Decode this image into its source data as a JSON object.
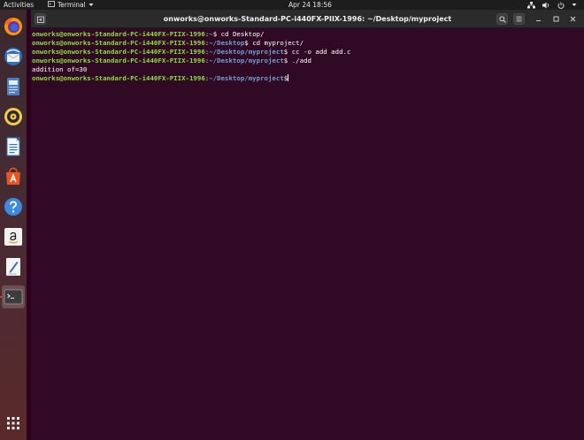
{
  "topbar": {
    "activities": "Activities",
    "app_menu": "Terminal",
    "clock": "Apr 24  18:56"
  },
  "dock": {
    "items": [
      {
        "name": "firefox",
        "icon": "firefox-icon"
      },
      {
        "name": "thunderbird",
        "icon": "thunderbird-mail-icon"
      },
      {
        "name": "files",
        "icon": "files-icon"
      },
      {
        "name": "rhythmbox",
        "icon": "rhythmbox-icon"
      },
      {
        "name": "libreoffice-writer",
        "icon": "libreoffice-writer-icon"
      },
      {
        "name": "ubuntu-software",
        "icon": "ubuntu-software-icon"
      },
      {
        "name": "help",
        "icon": "help-icon"
      },
      {
        "name": "amazon",
        "icon": "amazon-icon"
      },
      {
        "name": "text-editor",
        "icon": "text-editor-icon"
      },
      {
        "name": "terminal",
        "icon": "terminal-icon"
      }
    ]
  },
  "window": {
    "title": "onworks@onworks-Standard-PC-i440FX-PIIX-1996: ~/Desktop/myproject"
  },
  "terminal": {
    "lines": [
      {
        "user": "onworks@onworks-Standard-PC-i440FX-PIIX-1996",
        "path": "~",
        "command": "cd Desktop/"
      },
      {
        "user": "onworks@onworks-Standard-PC-i440FX-PIIX-1996",
        "path": "~/Desktop",
        "command": "cd myproject/"
      },
      {
        "user": "onworks@onworks-Standard-PC-i440FX-PIIX-1996",
        "path": "~/Desktop/myproject",
        "command": "cc -o add add.c"
      },
      {
        "user": "onworks@onworks-Standard-PC-i440FX-PIIX-1996",
        "path": "~/Desktop/myproject",
        "command": "./add"
      },
      {
        "output": "addition of=30"
      },
      {
        "user": "onworks@onworks-Standard-PC-i440FX-PIIX-1996",
        "path": "~/Desktop/myproject",
        "command": ""
      }
    ]
  },
  "colors": {
    "terminal_bg": "#300a24",
    "prompt_user": "#8ae234",
    "prompt_path": "#729fcf",
    "accent": "#e95420"
  }
}
